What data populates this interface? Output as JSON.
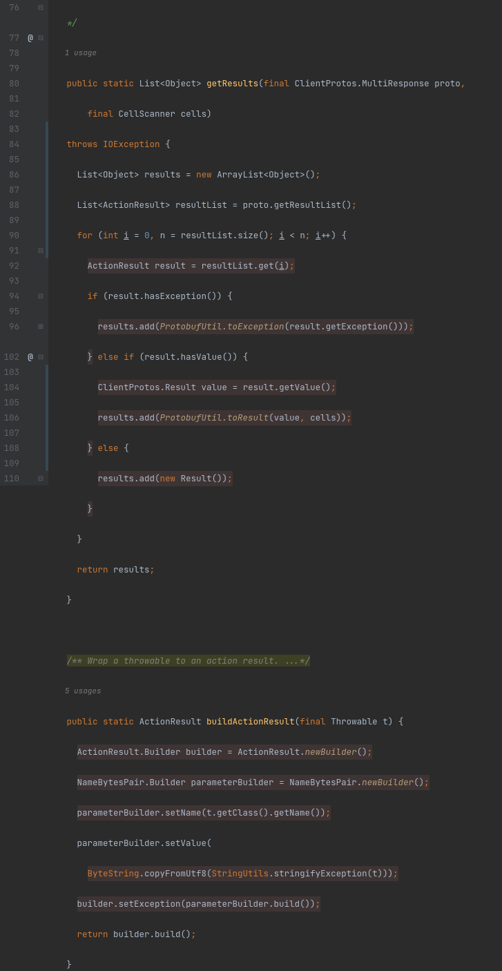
{
  "gutter": {
    "lines": [
      "76",
      "",
      "77",
      "78",
      "79",
      "80",
      "81",
      "82",
      "83",
      "84",
      "85",
      "86",
      "87",
      "88",
      "89",
      "90",
      "91",
      "92",
      "93",
      "94",
      "95",
      "96",
      "",
      "102",
      "103",
      "104",
      "105",
      "106",
      "107",
      "108",
      "109",
      "110"
    ],
    "bookmarks": {
      "77": "@",
      "102": "@"
    },
    "folds": {
      "76": "⊟",
      "77": "⊟",
      "79": "",
      "82": "",
      "84": "",
      "86": "",
      "89": "",
      "91": "⊟",
      "92": "",
      "94": "⊟",
      "96": "⊞",
      "102": "⊟",
      "110": "⊟"
    }
  },
  "usages": {
    "line76": "1 usage",
    "line96": "5 usages"
  },
  "code": {
    "l76": "   */",
    "l77_pub": "public",
    "l77_static": "static",
    "l77_list": "List<Object>",
    "l77_method": "getResults",
    "l77_final": "final",
    "l77_cp": "ClientProtos.MultiResponse",
    "l77_p": "proto",
    "l78_final": "final",
    "l78_cs": "CellScanner",
    "l78_cells": "cells",
    "l79_throws": "throws",
    "l79_io": "IOException",
    "l80_list": "List<Object>",
    "l80_res": "results",
    "l80_eq": "=",
    "l80_new": "new",
    "l80_al": "ArrayList<Object>",
    "l81_list": "List<ActionResult>",
    "l81_rl": "resultList",
    "l81_eq": "=",
    "l81_proto": "proto.getResultList()",
    "l82_for": "for",
    "l82_int": "int",
    "l82_i": "i",
    "l82_eq": "=",
    "l82_z": "0",
    "l82_n": "n",
    "l82_eq2": "=",
    "l82_rls": "resultList.size()",
    "l82_cond": "i",
    "l82_lt": "<",
    "l82_n2": "n",
    "l82_inc": "i",
    "l82_pp": "++",
    "l83_ar": "ActionResult",
    "l83_res": "result",
    "l83_eq": "=",
    "l83_get": "resultList.get(",
    "l83_i": "i",
    "l84_if": "if",
    "l84_cond": "(result.hasException())",
    "l85_add": "results.add(",
    "l85_pb": "ProtobufUtil",
    "l85_toe": ".toException",
    "l85_arg": "(result.getException()))",
    "l86_else": "else",
    "l86_if": "if",
    "l86_cond": "(result.hasValue())",
    "l87_cpr": "ClientProtos.Result",
    "l87_val": "value",
    "l87_eq": "=",
    "l87_rgv": "result.getValue()",
    "l88_add": "results.add(",
    "l88_pb": "ProtobufUtil",
    "l88_tor": ".toResult",
    "l88_args": "(value",
    "l88_cells": "cells",
    "l89_else": "else",
    "l90_add": "results.add(",
    "l90_new": "new",
    "l90_res": "Result())",
    "l93_ret": "return",
    "l93_res": "results",
    "l96_comment": "/** Wrap a throwable to an action result. ...*/",
    "l102_pub": "public",
    "l102_static": "static",
    "l102_ar": "ActionResult",
    "l102_method": "buildActionResult",
    "l102_final": "final",
    "l102_thr": "Throwable",
    "l102_t": "t",
    "l103_arb": "ActionResult.Builder",
    "l103_b": "builder",
    "l103_eq": "=",
    "l103_arn": "ActionResult.",
    "l103_nb": "newBuilder",
    "l104_nbp": "NameBytesPair.Builder",
    "l104_pb": "parameterBuilder",
    "l104_eq": "=",
    "l104_nbn": "NameBytesPair.",
    "l104_nb": "newBuilder",
    "l105_sn": "parameterBuilder.setName(t.getClass().getName())",
    "l106_sv": "parameterBuilder.setValue(",
    "l107_bs": "ByteString",
    "l107_cfu": ".copyFromUtf8(",
    "l107_su": "StringUtils",
    "l107_se": ".stringifyException(t)))",
    "l108_bse": "builder.setException(parameterBuilder.build())",
    "l109_ret": "return",
    "l109_bb": "builder.build()"
  }
}
